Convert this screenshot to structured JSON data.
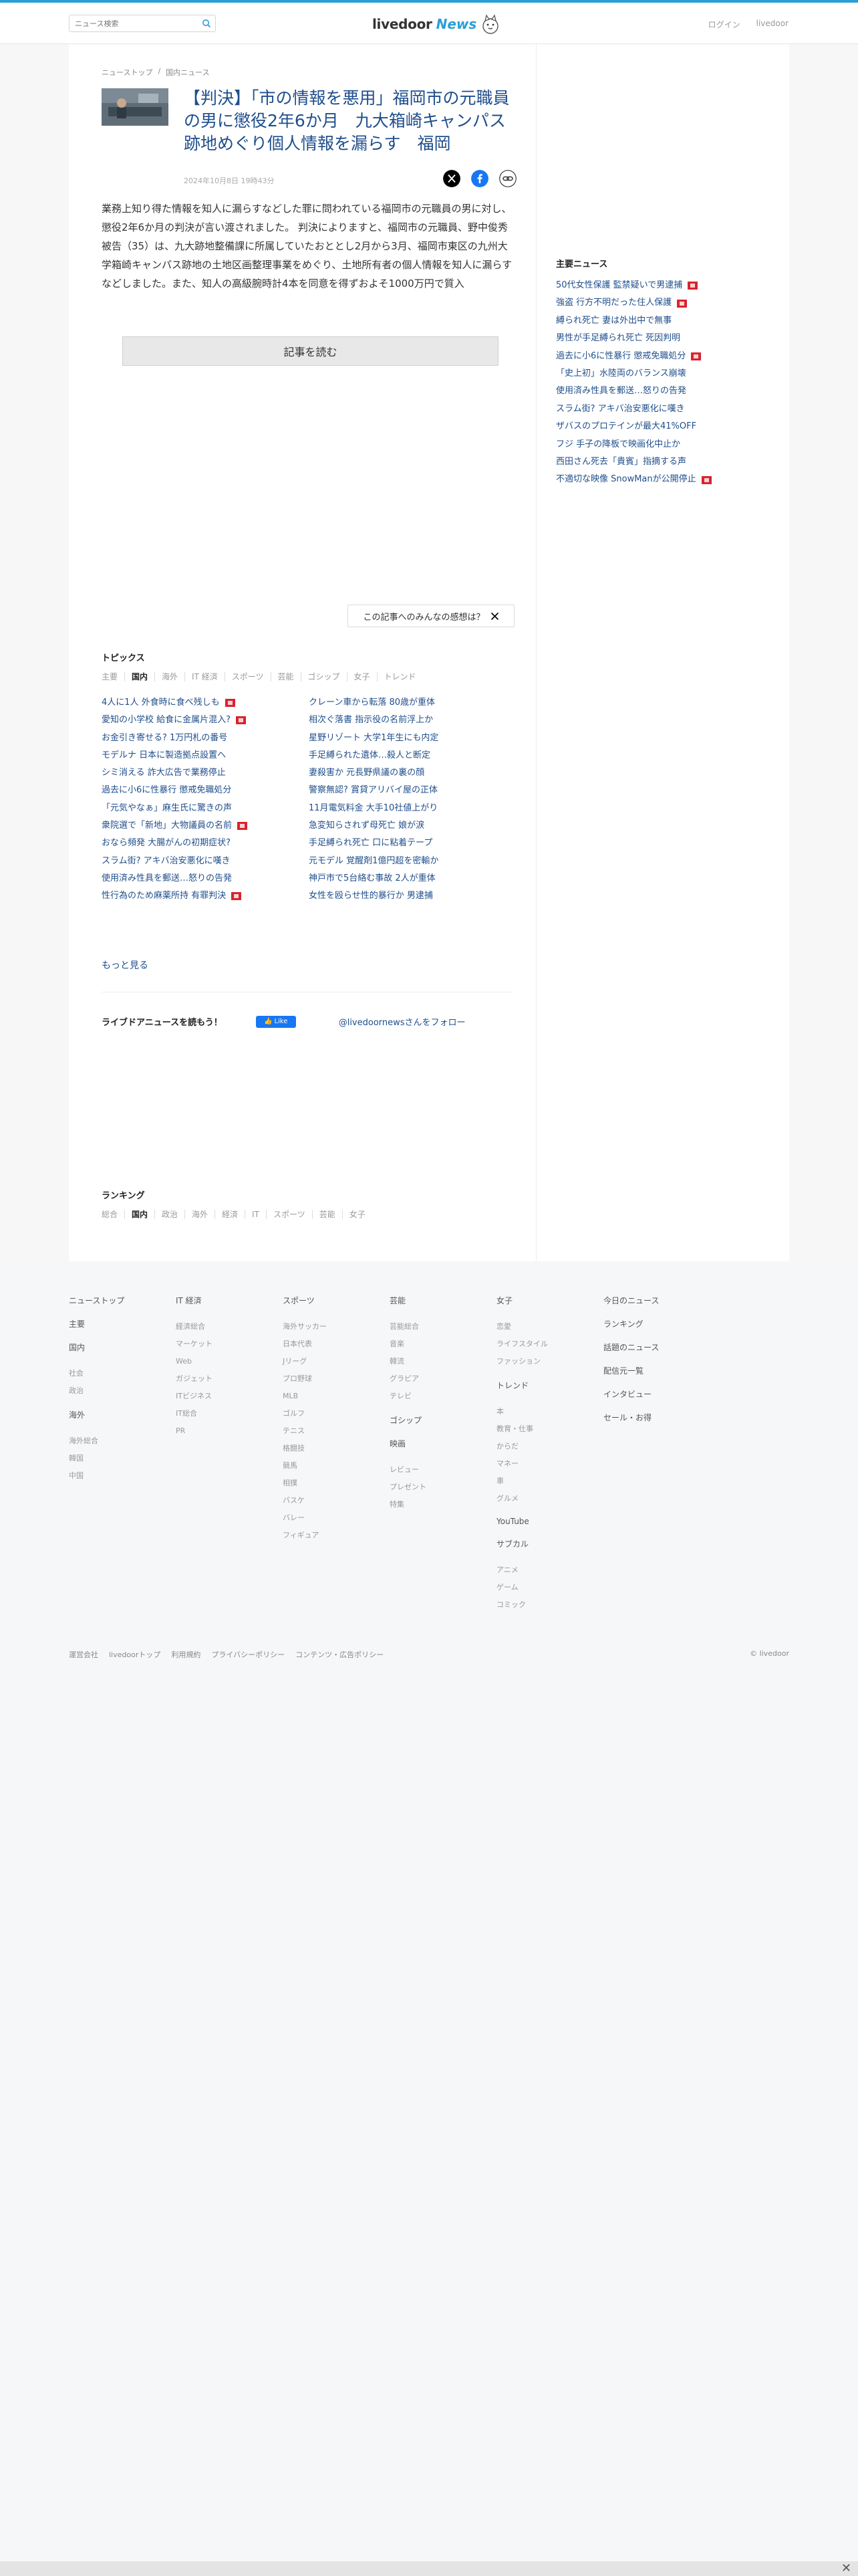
{
  "header": {
    "search_placeholder": "ニュース検索",
    "logo_main": "livedoor",
    "logo_sub": "News",
    "login": "ログイン",
    "livedoor": "livedoor"
  },
  "breadcrumb": [
    "ニューストップ",
    "国内ニュース"
  ],
  "article": {
    "title": "【判決】「市の情報を悪用」福岡市の元職員の男に懲役2年6か月　九大箱崎キャンパス跡地めぐり個人情報を漏らす　福岡",
    "date": "2024年10月8日 19時43分",
    "body": "業務上知り得た情報を知人に漏らすなどした罪に問われている福岡市の元職員の男に対し、懲役2年6か月の判決が言い渡されました。 判決によりますと、福岡市の元職員、野中俊秀被告（35）は、九大跡地整備課に所属していたおととし2月から3月、福岡市東区の九州大学箱崎キャンパス跡地の土地区画整理事業をめぐり、土地所有者の個人情報を知人に漏らすなどしました。また、知人の高級腕時計4本を同意を得ずおよそ1000万円で質入",
    "read_button": "記事を読む",
    "opinion_button": "この記事へのみんなの感想は？"
  },
  "topics": {
    "title": "トピックス",
    "tabs": [
      "主要",
      "国内",
      "海外",
      "IT 経済",
      "スポーツ",
      "芸能",
      "ゴシップ",
      "女子",
      "トレンド"
    ],
    "active_tab": "国内",
    "items_left": [
      {
        "text": "4人に1人 外食時に食べ残しも",
        "new": true
      },
      {
        "text": "愛知の小学校 給食に金属片混入?",
        "new": true
      },
      {
        "text": "お金引き寄せる? 1万円札の番号",
        "new": false
      },
      {
        "text": "モデルナ 日本に製造拠点設置へ",
        "new": false
      },
      {
        "text": "シミ消える 詐大広告で業務停止",
        "new": false
      },
      {
        "text": "過去に小6に性暴行 懲戒免職処分",
        "new": false
      },
      {
        "text": "「元気やなぁ」麻生氏に驚きの声",
        "new": false
      },
      {
        "text": "衆院選で「新地」大物議員の名前",
        "new": true
      },
      {
        "text": "おなら頻発 大腸がんの初期症状?",
        "new": false
      },
      {
        "text": "スラム街? アキバ治安悪化に嘆き",
        "new": false
      },
      {
        "text": "使用済み性具を郵送…怒りの告発",
        "new": false
      },
      {
        "text": "性行為のため麻薬所持 有罪判決",
        "new": true
      }
    ],
    "items_right": [
      {
        "text": "クレーン車から転落 80歳が重体",
        "new": false
      },
      {
        "text": "相次ぐ落書 指示役の名前浮上か",
        "new": false
      },
      {
        "text": "星野リゾート 大学1年生にも内定",
        "new": false
      },
      {
        "text": "手足縛られた遺体…殺人と断定",
        "new": false
      },
      {
        "text": "妻殺害か 元長野県議の裏の顔",
        "new": false
      },
      {
        "text": "警察無認? 賞貸アリバイ屋の正体",
        "new": false
      },
      {
        "text": "11月電気料金 大手10社値上がり",
        "new": false
      },
      {
        "text": "急変知らされず母死亡 娘が涙",
        "new": false
      },
      {
        "text": "手足縛られ死亡 口に粘着テープ",
        "new": false
      },
      {
        "text": "元モデル 覚醒剤1億円超を密輸か",
        "new": false
      },
      {
        "text": "神戸市で5台絡む事故 2人が重体",
        "new": false
      },
      {
        "text": "女性を殴らせ性的暴行か 男逮捕",
        "new": false
      }
    ],
    "more": "もっと見る"
  },
  "follow": {
    "text": "ライブドアニュースを読もう！",
    "like": "Like",
    "twitter": "@livedoornewsさんをフォロー"
  },
  "ranking": {
    "title": "ランキング",
    "tabs": [
      "総合",
      "国内",
      "政治",
      "海外",
      "経済",
      "IT",
      "スポーツ",
      "芸能",
      "女子"
    ],
    "active_tab": "国内"
  },
  "sidebar": {
    "title": "主要ニュース",
    "items": [
      {
        "text": "50代女性保護 監禁疑いで男逮捕",
        "new": true
      },
      {
        "text": "強盗 行方不明だった住人保護",
        "new": true
      },
      {
        "text": "縛られ死亡 妻は外出中で無事",
        "new": false
      },
      {
        "text": "男性が手足縛られ死亡 死因判明",
        "new": false
      },
      {
        "text": "過去に小6に性暴行 懲戒免職処分",
        "new": true
      },
      {
        "text": "「史上初」水陸両のバランス崩壊",
        "new": false
      },
      {
        "text": "使用済み性具を郵送…怒りの告発",
        "new": false
      },
      {
        "text": "スラム街? アキバ治安悪化に嘆き",
        "new": false
      },
      {
        "text": "ザバスのプロテインが最大41%OFF",
        "new": false
      },
      {
        "text": "フジ 手子の降板で映画化中止か",
        "new": false
      },
      {
        "text": "西田さん死去「貴賓」指摘する声",
        "new": false
      },
      {
        "text": "不適切な映像 SnowManが公開停止",
        "new": true
      }
    ]
  },
  "footer": {
    "cols": [
      {
        "head": "ニューストップ",
        "groups": [
          {
            "title": "主要",
            "items": []
          },
          {
            "title": "国内",
            "items": [
              "社会",
              "政治"
            ]
          },
          {
            "title": "海外",
            "items": [
              "海外総合",
              "韓国",
              "中国"
            ]
          }
        ]
      },
      {
        "head": "IT 経済",
        "groups": [
          {
            "title": "",
            "items": [
              "経済総合",
              "マーケット",
              "Web",
              "ガジェット",
              "ITビジネス",
              "IT総合",
              "PR"
            ]
          }
        ]
      },
      {
        "head": "スポーツ",
        "groups": [
          {
            "title": "",
            "items": [
              "海外サッカー",
              "日本代表",
              "Jリーグ",
              "プロ野球",
              "MLB",
              "ゴルフ",
              "テニス",
              "格闘技",
              "競馬",
              "相撲",
              "バスケ",
              "バレー",
              "フィギュア"
            ]
          }
        ]
      },
      {
        "head": "芸能",
        "groups": [
          {
            "title": "",
            "items": [
              "芸能総合",
              "音楽",
              "韓流",
              "グラビア",
              "テレビ"
            ]
          },
          {
            "title": "ゴシップ",
            "items": []
          },
          {
            "title": "映画",
            "items": [
              "レビュー",
              "プレゼント",
              "特集"
            ]
          }
        ]
      },
      {
        "head": "女子",
        "groups": [
          {
            "title": "",
            "items": [
              "恋愛",
              "ライフスタイル",
              "ファッション"
            ]
          },
          {
            "title": "トレンド",
            "items": [
              "本",
              "教育・仕事",
              "からだ",
              "マネー",
              "車",
              "グルメ"
            ]
          },
          {
            "title": "YouTube",
            "items": []
          },
          {
            "title": "サブカル",
            "items": [
              "アニメ",
              "ゲーム",
              "コミック"
            ]
          }
        ]
      },
      {
        "head": "今日のニュース",
        "groups": [
          {
            "title": "ランキング",
            "items": []
          },
          {
            "title": "話題のニュース",
            "items": []
          },
          {
            "title": "配信元一覧",
            "items": []
          },
          {
            "title": "インタビュー",
            "items": []
          },
          {
            "title": "セール・お得",
            "items": []
          }
        ]
      }
    ],
    "bottom_links": [
      "運営会社",
      "livedoorトップ",
      "利用規約",
      "プライバシーポリシー",
      "コンテンツ・広告ポリシー"
    ],
    "copyright": "© livedoor"
  }
}
